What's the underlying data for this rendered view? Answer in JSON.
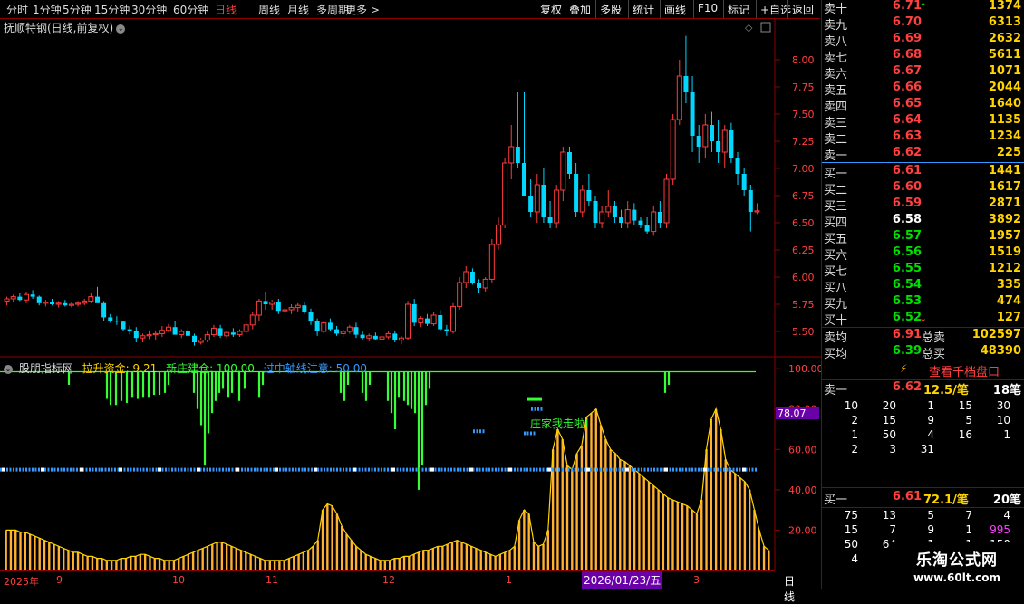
{
  "toolbar": {
    "periods": [
      "分时",
      "1分钟",
      "5分钟",
      "15分钟",
      "30分钟",
      "60分钟",
      "日线",
      "周线",
      "月线",
      "多周期",
      "更多 >"
    ],
    "active": "日线",
    "actions": [
      "复权",
      "叠加",
      "多股",
      "统计",
      "画线",
      "F10",
      "标记",
      "+自选",
      "返回"
    ]
  },
  "chart_title": "抚顺特钢(日线,前复权)",
  "indicator": {
    "name": "股朋指标网",
    "line1": "拉升资金: 9.21",
    "line2": "新庄建仓: 100.00",
    "line3": "过中轴线注意: 50.00",
    "annotation": "庄家我走啦!",
    "value_tag": "78.07"
  },
  "chart_data": {
    "type": "candlestick",
    "price_ticks": [
      "8.00",
      "7.75",
      "7.50",
      "7.25",
      "7.00",
      "6.75",
      "6.50",
      "6.25",
      "6.00",
      "5.75",
      "5.50"
    ],
    "indicator_ticks": [
      "100.00",
      "80.00",
      "60.00",
      "40.00",
      "20.00"
    ],
    "x_labels": [
      "2025年",
      "9",
      "10",
      "11",
      "12",
      "1",
      "2026/01/23/五",
      "3"
    ],
    "period_label": "日线",
    "ylim": [
      5.3,
      8.3
    ],
    "candles": [
      [
        5.78,
        5.82,
        5.74,
        5.8
      ],
      [
        5.8,
        5.84,
        5.77,
        5.82
      ],
      [
        5.82,
        5.85,
        5.78,
        5.79
      ],
      [
        5.79,
        5.86,
        5.76,
        5.84
      ],
      [
        5.84,
        5.88,
        5.8,
        5.82
      ],
      [
        5.82,
        5.83,
        5.74,
        5.76
      ],
      [
        5.76,
        5.79,
        5.73,
        5.77
      ],
      [
        5.77,
        5.8,
        5.74,
        5.75
      ],
      [
        5.75,
        5.78,
        5.72,
        5.76
      ],
      [
        5.76,
        5.79,
        5.73,
        5.74
      ],
      [
        5.74,
        5.77,
        5.72,
        5.75
      ],
      [
        5.75,
        5.78,
        5.73,
        5.76
      ],
      [
        5.76,
        5.8,
        5.74,
        5.78
      ],
      [
        5.78,
        5.85,
        5.76,
        5.82
      ],
      [
        5.82,
        5.91,
        5.78,
        5.76
      ],
      [
        5.76,
        5.78,
        5.6,
        5.63
      ],
      [
        5.63,
        5.66,
        5.58,
        5.6
      ],
      [
        5.6,
        5.64,
        5.56,
        5.59
      ],
      [
        5.59,
        5.6,
        5.5,
        5.52
      ],
      [
        5.52,
        5.55,
        5.47,
        5.5
      ],
      [
        5.5,
        5.54,
        5.4,
        5.44
      ],
      [
        5.44,
        5.48,
        5.4,
        5.46
      ],
      [
        5.46,
        5.51,
        5.43,
        5.47
      ],
      [
        5.47,
        5.5,
        5.42,
        5.48
      ],
      [
        5.48,
        5.55,
        5.45,
        5.51
      ],
      [
        5.51,
        5.57,
        5.49,
        5.54
      ],
      [
        5.54,
        5.6,
        5.5,
        5.47
      ],
      [
        5.47,
        5.52,
        5.44,
        5.5
      ],
      [
        5.5,
        5.54,
        5.45,
        5.46
      ],
      [
        5.46,
        5.48,
        5.37,
        5.4
      ],
      [
        5.4,
        5.44,
        5.38,
        5.42
      ],
      [
        5.42,
        5.5,
        5.4,
        5.47
      ],
      [
        5.47,
        5.56,
        5.45,
        5.53
      ],
      [
        5.53,
        5.56,
        5.44,
        5.46
      ],
      [
        5.46,
        5.51,
        5.44,
        5.49
      ],
      [
        5.49,
        5.53,
        5.45,
        5.47
      ],
      [
        5.47,
        5.52,
        5.45,
        5.5
      ],
      [
        5.5,
        5.6,
        5.48,
        5.56
      ],
      [
        5.56,
        5.68,
        5.52,
        5.65
      ],
      [
        5.65,
        5.8,
        5.6,
        5.78
      ],
      [
        5.78,
        5.86,
        5.7,
        5.75
      ],
      [
        5.75,
        5.79,
        5.7,
        5.77
      ],
      [
        5.77,
        5.8,
        5.66,
        5.69
      ],
      [
        5.69,
        5.72,
        5.64,
        5.7
      ],
      [
        5.7,
        5.75,
        5.66,
        5.72
      ],
      [
        5.72,
        5.76,
        5.68,
        5.74
      ],
      [
        5.74,
        5.77,
        5.66,
        5.68
      ],
      [
        5.68,
        5.71,
        5.56,
        5.6
      ],
      [
        5.6,
        5.62,
        5.46,
        5.5
      ],
      [
        5.5,
        5.6,
        5.48,
        5.58
      ],
      [
        5.58,
        5.62,
        5.5,
        5.52
      ],
      [
        5.52,
        5.55,
        5.46,
        5.48
      ],
      [
        5.48,
        5.52,
        5.45,
        5.5
      ],
      [
        5.5,
        5.56,
        5.48,
        5.54
      ],
      [
        5.54,
        5.58,
        5.44,
        5.47
      ],
      [
        5.47,
        5.5,
        5.42,
        5.44
      ],
      [
        5.44,
        5.48,
        5.41,
        5.46
      ],
      [
        5.46,
        5.49,
        5.42,
        5.43
      ],
      [
        5.43,
        5.47,
        5.4,
        5.45
      ],
      [
        5.45,
        5.5,
        5.43,
        5.48
      ],
      [
        5.48,
        5.5,
        5.4,
        5.42
      ],
      [
        5.42,
        5.46,
        5.38,
        5.44
      ],
      [
        5.44,
        5.78,
        5.42,
        5.75
      ],
      [
        5.75,
        5.8,
        5.55,
        5.58
      ],
      [
        5.58,
        5.64,
        5.54,
        5.62
      ],
      [
        5.62,
        5.66,
        5.55,
        5.57
      ],
      [
        5.57,
        5.68,
        5.55,
        5.65
      ],
      [
        5.65,
        5.7,
        5.5,
        5.52
      ],
      [
        5.52,
        5.56,
        5.46,
        5.5
      ],
      [
        5.5,
        5.76,
        5.48,
        5.73
      ],
      [
        5.73,
        6.0,
        5.7,
        5.95
      ],
      [
        5.95,
        6.1,
        5.9,
        6.05
      ],
      [
        6.05,
        6.08,
        5.93,
        5.95
      ],
      [
        5.95,
        5.98,
        5.85,
        5.9
      ],
      [
        5.9,
        6.0,
        5.86,
        5.98
      ],
      [
        5.98,
        6.35,
        5.95,
        6.3
      ],
      [
        6.3,
        6.55,
        6.25,
        6.48
      ],
      [
        6.48,
        7.1,
        6.45,
        7.05
      ],
      [
        7.05,
        7.4,
        6.9,
        7.2
      ],
      [
        7.2,
        7.7,
        7.0,
        7.05
      ],
      [
        7.05,
        7.7,
        6.85,
        6.75
      ],
      [
        6.75,
        6.9,
        6.55,
        6.6
      ],
      [
        6.6,
        6.95,
        6.5,
        6.85
      ],
      [
        6.85,
        7.0,
        6.5,
        6.55
      ],
      [
        6.55,
        6.7,
        6.45,
        6.5
      ],
      [
        6.5,
        6.85,
        6.45,
        6.8
      ],
      [
        6.8,
        7.2,
        6.7,
        7.15
      ],
      [
        7.15,
        7.2,
        6.9,
        6.95
      ],
      [
        6.95,
        7.05,
        6.55,
        6.6
      ],
      [
        6.6,
        6.85,
        6.55,
        6.8
      ],
      [
        6.8,
        6.95,
        6.65,
        6.7
      ],
      [
        6.7,
        6.75,
        6.45,
        6.5
      ],
      [
        6.5,
        6.65,
        6.45,
        6.6
      ],
      [
        6.6,
        6.8,
        6.55,
        6.65
      ],
      [
        6.65,
        6.7,
        6.5,
        6.55
      ],
      [
        6.55,
        6.62,
        6.45,
        6.5
      ],
      [
        6.5,
        6.7,
        6.45,
        6.62
      ],
      [
        6.62,
        6.68,
        6.48,
        6.52
      ],
      [
        6.52,
        6.55,
        6.45,
        6.48
      ],
      [
        6.48,
        6.55,
        6.4,
        6.42
      ],
      [
        6.42,
        6.65,
        6.38,
        6.6
      ],
      [
        6.6,
        6.7,
        6.45,
        6.5
      ],
      [
        6.5,
        6.95,
        6.45,
        6.9
      ],
      [
        6.9,
        7.5,
        6.85,
        7.45
      ],
      [
        7.45,
        8.0,
        7.4,
        7.85
      ],
      [
        7.85,
        8.22,
        7.6,
        7.7
      ],
      [
        7.7,
        7.85,
        7.15,
        7.3
      ],
      [
        7.3,
        7.4,
        7.05,
        7.2
      ],
      [
        7.2,
        7.5,
        7.1,
        7.4
      ],
      [
        7.4,
        7.52,
        7.15,
        7.25
      ],
      [
        7.25,
        7.45,
        7.05,
        7.15
      ],
      [
        7.15,
        7.4,
        7.0,
        7.35
      ],
      [
        7.35,
        7.42,
        7.05,
        7.1
      ],
      [
        7.1,
        7.15,
        6.85,
        6.95
      ],
      [
        6.95,
        7.0,
        6.75,
        6.8
      ],
      [
        6.8,
        6.85,
        6.42,
        6.6
      ],
      [
        6.6,
        6.68,
        6.58,
        6.61
      ]
    ],
    "indicator_series": {
      "name": "拉升资金",
      "values": [
        20,
        20,
        20,
        19,
        19,
        18,
        17,
        16,
        15,
        14,
        13,
        12,
        11,
        10,
        9,
        9,
        8,
        7,
        7,
        6,
        6,
        5,
        5,
        5,
        6,
        6,
        7,
        7,
        8,
        8,
        7,
        6,
        6,
        5,
        5,
        5,
        6,
        7,
        8,
        9,
        10,
        11,
        12,
        13,
        14,
        14,
        13,
        12,
        11,
        10,
        9,
        8,
        7,
        6,
        5,
        5,
        5,
        5,
        5,
        6,
        7,
        8,
        9,
        10,
        12,
        15,
        30,
        33,
        32,
        28,
        22,
        18,
        15,
        12,
        10,
        8,
        7,
        6,
        5,
        5,
        5,
        6,
        6,
        7,
        7,
        8,
        9,
        10,
        10,
        11,
        12,
        12,
        13,
        14,
        15,
        14,
        13,
        12,
        11,
        10,
        9,
        8,
        7,
        8,
        9,
        10,
        12,
        25,
        30,
        28,
        14,
        12,
        13,
        20,
        60,
        70,
        65,
        52,
        50,
        58,
        62,
        76,
        78,
        80,
        72,
        65,
        60,
        58,
        55,
        54,
        52,
        50,
        48,
        46,
        44,
        42,
        40,
        38,
        36,
        35,
        34,
        33,
        32,
        30,
        28,
        35,
        60,
        75,
        80,
        70,
        55,
        50,
        48,
        46,
        44,
        40,
        30,
        20,
        12,
        10
      ]
    },
    "overlay_line_level": 50,
    "top_line_level": 98.5
  },
  "orderbook": {
    "sells": [
      {
        "label": "卖十",
        "price": "6.71",
        "vol": "1374"
      },
      {
        "label": "卖九",
        "price": "6.70",
        "vol": "6313"
      },
      {
        "label": "卖八",
        "price": "6.69",
        "vol": "2632"
      },
      {
        "label": "卖七",
        "price": "6.68",
        "vol": "5611"
      },
      {
        "label": "卖六",
        "price": "6.67",
        "vol": "1071"
      },
      {
        "label": "卖五",
        "price": "6.66",
        "vol": "2044"
      },
      {
        "label": "卖四",
        "price": "6.65",
        "vol": "1640"
      },
      {
        "label": "卖三",
        "price": "6.64",
        "vol": "1135"
      },
      {
        "label": "卖二",
        "price": "6.63",
        "vol": "1234"
      },
      {
        "label": "卖一",
        "price": "6.62",
        "vol": "225"
      }
    ],
    "buys": [
      {
        "label": "买一",
        "price": "6.61",
        "vol": "1441",
        "c": "red"
      },
      {
        "label": "买二",
        "price": "6.60",
        "vol": "1617",
        "c": "red"
      },
      {
        "label": "买三",
        "price": "6.59",
        "vol": "2871",
        "c": "red"
      },
      {
        "label": "买四",
        "price": "6.58",
        "vol": "3892",
        "c": "white"
      },
      {
        "label": "买五",
        "price": "6.57",
        "vol": "1957",
        "c": "green"
      },
      {
        "label": "买六",
        "price": "6.56",
        "vol": "1519",
        "c": "green"
      },
      {
        "label": "买七",
        "price": "6.55",
        "vol": "1212",
        "c": "green"
      },
      {
        "label": "买八",
        "price": "6.54",
        "vol": "335",
        "c": "green"
      },
      {
        "label": "买九",
        "price": "6.53",
        "vol": "474",
        "c": "green"
      },
      {
        "label": "买十",
        "price": "6.52",
        "vol": "127",
        "c": "green"
      }
    ],
    "avg": [
      {
        "label": "卖均",
        "price": "6.91",
        "tlabel": "总卖",
        "vol": "102597"
      },
      {
        "label": "买均",
        "price": "6.39",
        "tlabel": "总买",
        "vol": "48390"
      }
    ],
    "qian_label": "查看千档盘口",
    "sell1": {
      "label": "卖一",
      "price": "6.62",
      "avg": "12.5/笔",
      "count": "18笔"
    },
    "sell_grid": [
      [
        "10",
        "20",
        "1",
        "15",
        "30"
      ],
      [
        "2",
        "15",
        "9",
        "5",
        "10"
      ],
      [
        "1",
        "50",
        "4",
        "16",
        "1"
      ],
      [
        "2",
        "3",
        "31",
        "",
        ""
      ]
    ],
    "buy1": {
      "label": "买一",
      "price": "6.61",
      "avg": "72.1/笔",
      "count": "20笔"
    },
    "buy_grid": [
      [
        "75",
        "13",
        "5",
        "7",
        "4"
      ],
      [
        "15",
        "7",
        "9",
        "1",
        "995"
      ],
      [
        "50",
        "64",
        "1",
        "1",
        "150"
      ],
      [
        "4",
        "",
        "",
        "",
        ""
      ]
    ]
  },
  "logo": {
    "name": "乐淘公式网",
    "url": "www.60lt.com"
  },
  "colors": {
    "up": "#ff3b3b",
    "down": "#00d8ff",
    "grid": "#8b0000",
    "indicator_bar": "#ffb030",
    "green_bar": "#33ff33",
    "overlay": "#3399ff"
  }
}
